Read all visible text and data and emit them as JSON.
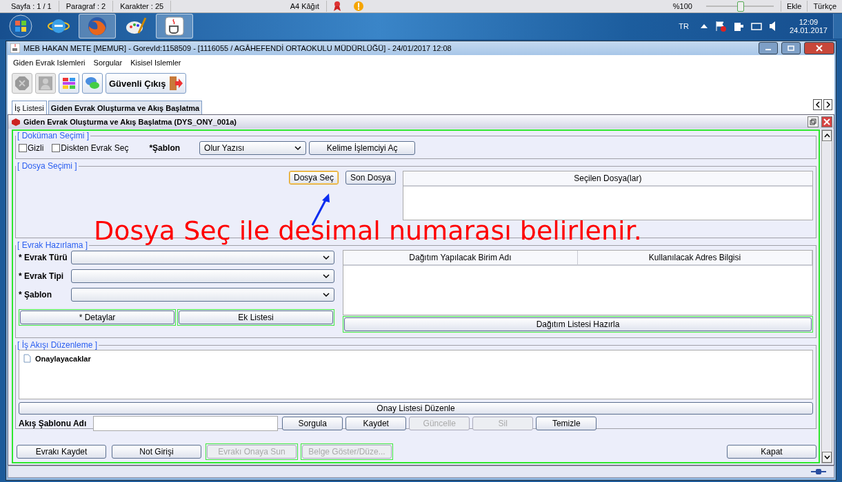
{
  "word_status": {
    "items": [
      "Sayfa : 1 / 1",
      "Paragraf : 2",
      "Karakter : 25"
    ],
    "paper": "A4 Kâğıt",
    "zoom": "%100",
    "zoom_slider": {
      "level": 0.5
    },
    "buttons": [
      "Ekle",
      "Türkçe"
    ]
  },
  "taskbar": {
    "apps": [
      {
        "kind": "ie",
        "selected": false
      },
      {
        "kind": "firefox",
        "selected": true
      },
      {
        "kind": "paint",
        "selected": false
      },
      {
        "kind": "java",
        "selected": true
      }
    ],
    "lang": "TR",
    "time": "12:09",
    "date": "24.01.2017"
  },
  "window": {
    "title": "MEB   HAKAN METE  [MEMUR] - GorevId:1158509 - [1116055 / AGÂHEFENDİ ORTAOKULU MÜDÜRLÜĞÜ] - 24/01/2017 12:08"
  },
  "menu": [
    "Giden Evrak Islemleri",
    "Sorgular",
    "Kisisel Islemler"
  ],
  "toolbar": {
    "buttons": [
      {
        "kind": "stop",
        "disabled": true
      },
      {
        "kind": "person",
        "disabled": true
      },
      {
        "kind": "grid",
        "disabled": false
      },
      {
        "kind": "chat",
        "disabled": false
      }
    ],
    "exit": "Güvenli Çıkış"
  },
  "tabs": [
    {
      "label": "İş Listesi",
      "selected": false
    },
    {
      "label": "Giden Evrak Oluşturma ve Akış Başlatma",
      "selected": true
    }
  ],
  "frame_title": "Giden Evrak Oluşturma ve Akış Başlatma (DYS_ONY_001a)",
  "document": {
    "title": "[ Doküman Seçimi ]",
    "checkboxes": [
      {
        "label": "Gizli",
        "checked": false
      },
      {
        "label": "Diskten Evrak Seç",
        "checked": false
      }
    ],
    "template_label": "*Şablon",
    "template_value": "Olur Yazısı",
    "open_button": "Kelime İşlemciyi Aç"
  },
  "file": {
    "title": "[ Dosya Seçimi ]",
    "buttons": [
      {
        "label": "Dosya Seç",
        "focused": true
      },
      {
        "label": "Son Dosya",
        "focused": false
      }
    ],
    "column": "Seçilen Dosya(lar)"
  },
  "prepare": {
    "title": "[ Evrak Hazırlama ]",
    "fields": [
      "* Evrak Türü",
      "* Evrak Tipi",
      "* Şablon"
    ],
    "buttons": [
      "* Detaylar",
      "Ek Listesi"
    ],
    "columns": [
      "Dağıtım Yapılacak Birim Adı",
      "Kullanılacak Adres Bilgisi"
    ],
    "list_button": "Dağıtım Listesi Hazırla"
  },
  "workflow": {
    "title": "[ İş Akışı Düzenleme ]",
    "tree": [
      {
        "label": "Onaylayacaklar"
      }
    ],
    "edit_button": "Onay Listesi Düzenle",
    "name_label": "Akış Şablonu Adı",
    "buttons": [
      {
        "label": "Sorgula",
        "disabled": false
      },
      {
        "label": "Kaydet",
        "disabled": false
      },
      {
        "label": "Güncelle",
        "disabled": true
      },
      {
        "label": "Sil",
        "disabled": true
      },
      {
        "label": "Temizle",
        "disabled": false
      }
    ]
  },
  "footer": {
    "buttons": [
      {
        "label": "Evrakı Kaydet",
        "disabled": false
      },
      {
        "label": "Not Girişi",
        "disabled": false
      },
      {
        "label": "Evrakı Onaya Sun",
        "disabled": true
      },
      {
        "label": "Belge Göster/Düze...",
        "disabled": true
      }
    ],
    "close": "Kapat"
  },
  "annotation": "Dosya Seç ile desimal numarası belirlenir."
}
